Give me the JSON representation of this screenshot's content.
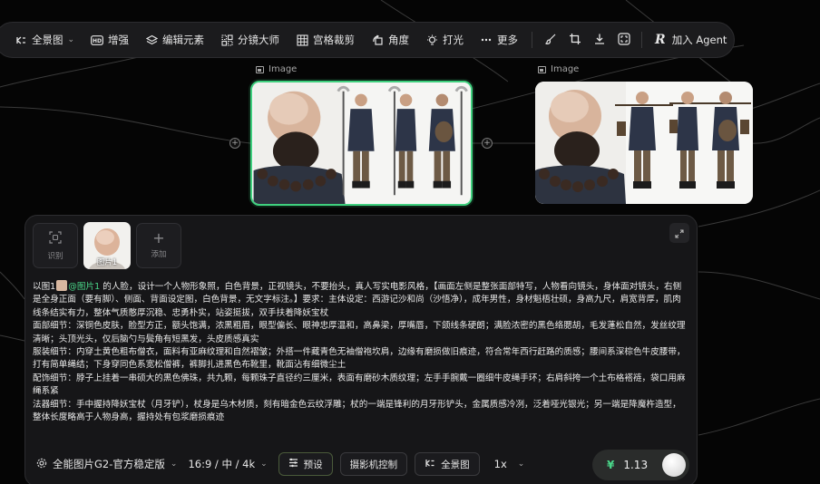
{
  "toolbar": {
    "panorama_label": "全景图",
    "enhance_label": "增强",
    "edit_elements_label": "编辑元素",
    "storyboard_label": "分镜大师",
    "grid_crop_label": "宫格裁剪",
    "angle_label": "角度",
    "lighting_label": "打光",
    "more_label": "更多",
    "agent_label": "加入 Agent",
    "icons": {
      "panorama": "panorama-icon",
      "enhance": "hd-icon",
      "edit_elements": "layers-icon",
      "storyboard": "storyboard-icon",
      "grid_crop": "grid-icon",
      "angle": "rotate-icon",
      "lighting": "bulb-icon",
      "more": "more-dots-icon",
      "brush": "brush-icon",
      "crop": "crop-icon",
      "download": "download-icon",
      "fullscreen": "fullscreen-icon",
      "agent": "agent-logo-icon"
    }
  },
  "canvas": {
    "node1_label": "Image",
    "node2_label": "Image",
    "node1_selected": true,
    "accent_color": "#3fd07e"
  },
  "prompt_panel": {
    "ref_recognize_label": "识别",
    "ref_image_label": "图片1",
    "ref_add_label": "添加",
    "prompt_prefix": "以图1",
    "prompt_mention": "@图片1",
    "prompt_line1_rest": " 的人脸，设计一个人物形象照，白色背景，正视镜头，不要抬头，真人写实电影风格，【画面左侧是整张面部特写，人物看向镜头，身体面对镜头，右侧是全身正面（要有脚）、侧面、背面设定图，白色背景，无文字标注。】要求：主体设定：西游记沙和尚（沙悟净），成年男性，身材魁梧壮硕，身高九尺，肩宽背厚，肌肉线条结实有力，整体气质憨厚沉稳、忠勇朴实，站姿挺拔，双手扶着降妖宝杖",
    "prompt_para2": "面部细节：深铜色皮肤，脸型方正，额头饱满，浓黑粗眉，眼型偏长、眼神忠厚温和，高鼻梁，厚嘴唇，下颌线条硬朗；满脸浓密的黑色络腮胡，毛发蓬松自然，发丝纹理清晰；头顶光头，仅后脑勺与鬓角有短黑发，头皮质感真实",
    "prompt_para3": "服装细节：内穿土黄色粗布僧衣，面料有亚麻纹理和自然褶皱；外搭一件藏青色无袖僧袍坎肩，边缘有磨损做旧痕迹，符合常年西行赶路的质感；腰间系深棕色牛皮腰带，打有简单绳结；下身穿同色系宽松僧裤，裤脚扎进黑色布靴里，靴面沾有细微尘土",
    "prompt_para4": "配饰细节：脖子上挂着一串硕大的黑色佛珠，共九颗，每颗珠子直径约三厘米，表面有磨砂木质纹理；左手手腕戴一圈细牛皮绳手环；右肩斜挎一个土布格褡裢，袋口用麻绳系紧",
    "prompt_para5": "法器细节：手中握持降妖宝杖（月牙铲），杖身是乌木材质，刻有暗金色云纹浮雕；杖的一端是锋利的月牙形铲头，金属质感冷冽，泛着哑光银光；另一端是降魔杵造型，整体长度略高于人物身高，握持处有包浆磨损痕迹"
  },
  "controls": {
    "model_label": "全能图片G2-官方稳定版",
    "ratio_label": "16:9 / 中 / 4k",
    "preset_label": "预设",
    "camera_label": "摄影机控制",
    "panorama_label": "全景图",
    "count_label": "1x",
    "cost_value": "1.13",
    "currency_symbol": "¥"
  }
}
